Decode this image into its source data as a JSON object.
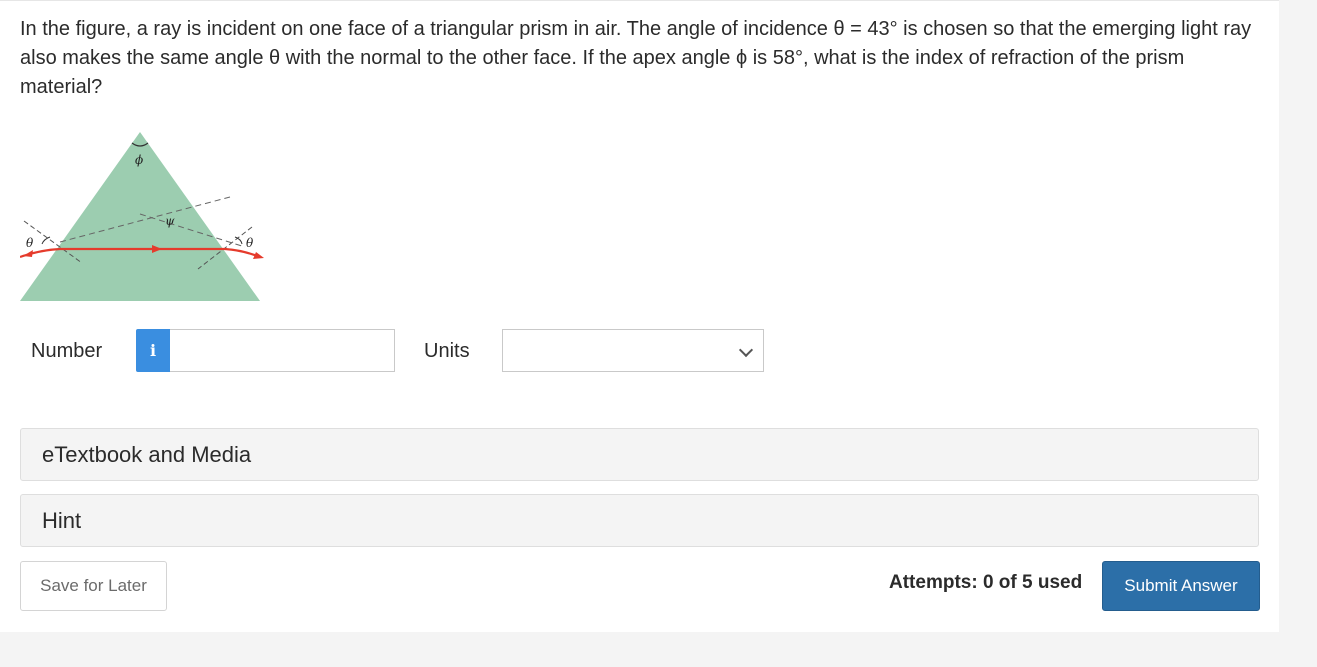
{
  "question": {
    "text": "In the figure, a ray is incident on one face of a triangular prism in air. The angle of incidence θ = 43° is chosen so that the emerging light ray also makes the same angle θ with the normal to the other face. If the apex angle ϕ is 58°, what is the index of refraction of the prism material?"
  },
  "figure": {
    "phi_label": "ϕ",
    "psi_label": "ψ",
    "theta_left_label": "θ",
    "theta_right_label": "θ",
    "prism_color": "#9ccdb0",
    "ray_color": "#e53b2c"
  },
  "answer": {
    "number_label": "Number",
    "info_icon": "i",
    "number_value": "",
    "units_label": "Units",
    "units_selected": ""
  },
  "panels": {
    "etextbook": "eTextbook and Media",
    "hint": "Hint"
  },
  "footer": {
    "save_label": "Save for Later",
    "attempts": "Attempts: 0 of 5 used",
    "submit_label": "Submit Answer"
  }
}
